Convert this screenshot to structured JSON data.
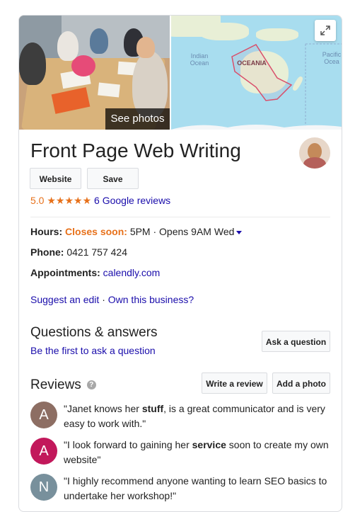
{
  "hero": {
    "see_photos_label": "See photos",
    "map_labels": {
      "indian_ocean": "Indian Ocean",
      "oceania": "OCEANIA",
      "pacific_ocean": "Pacific Ocea"
    },
    "expand_icon": "expand-icon"
  },
  "business": {
    "name": "Front Page Web Writing",
    "website_label": "Website",
    "save_label": "Save",
    "rating": "5.0",
    "stars": "★★★★★",
    "reviews_count_label": "6 Google reviews"
  },
  "info": {
    "hours_label": "Hours:",
    "hours_status": "Closes soon:",
    "hours_detail": "5PM · Opens 9AM Wed",
    "phone_label": "Phone:",
    "phone_value": "0421 757 424",
    "appointments_label": "Appointments:",
    "appointments_value": "calendly.com",
    "suggest_edit": "Suggest an edit",
    "separator": "·",
    "own_business": "Own this business?"
  },
  "qa": {
    "title": "Questions & answers",
    "first_link": "Be the first to ask a question",
    "ask_button": "Ask a question"
  },
  "reviews": {
    "title": "Reviews",
    "help_icon": "?",
    "write_review_label": "Write a review",
    "add_photo_label": "Add a photo",
    "items": [
      {
        "initial": "A",
        "color": "#8d6e63",
        "before": "\"Janet knows her ",
        "bold": "stuff",
        "after": ", is a great communicator and is very easy to work with.\""
      },
      {
        "initial": "A",
        "color": "#c2185b",
        "before": "\"I look forward to gaining her ",
        "bold": "service",
        "after": " soon to create my own website\""
      },
      {
        "initial": "N",
        "color": "#78909c",
        "before": "\"I highly recommend anyone wanting to learn SEO basics to undertake her workshop!\"",
        "bold": "",
        "after": ""
      }
    ]
  },
  "colors": {
    "accent_orange": "#e7711b",
    "link_blue": "#1a0dab",
    "map_water": "#a8ddef"
  }
}
